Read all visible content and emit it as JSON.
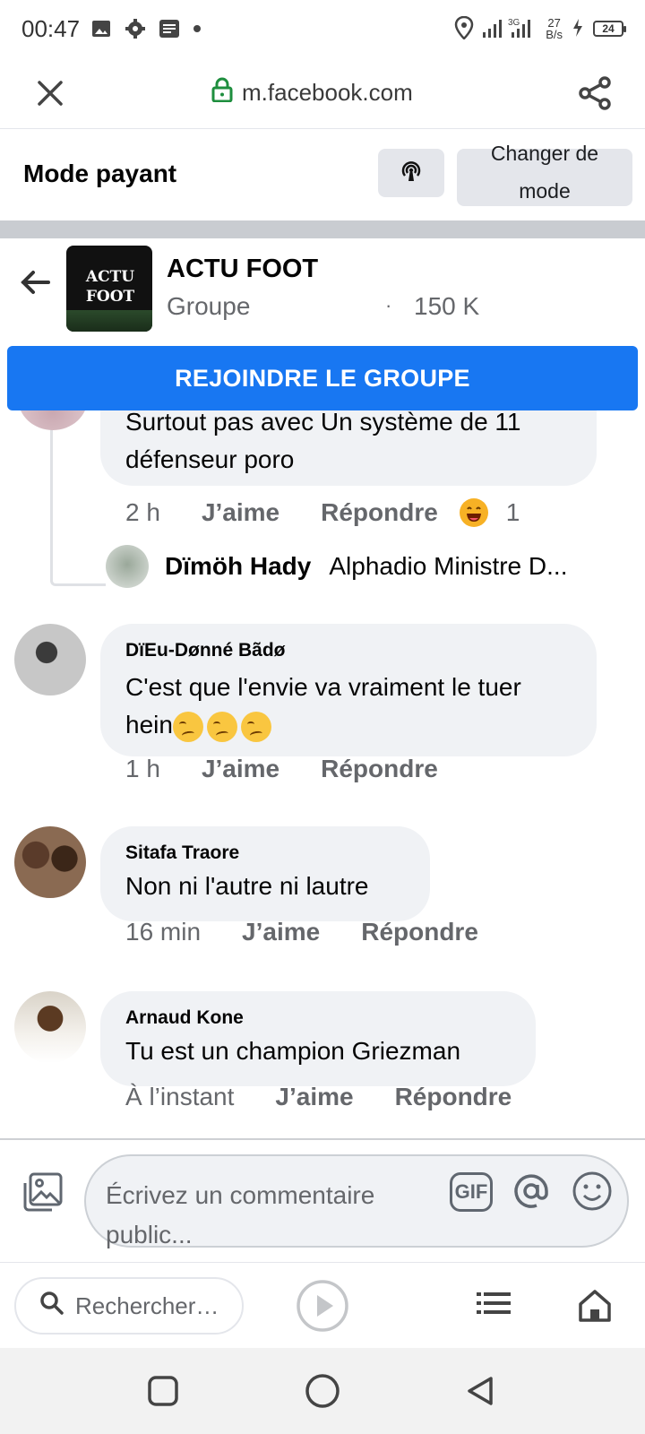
{
  "status_bar": {
    "time": "00:47",
    "network": "3G",
    "speed_value": "27",
    "speed_unit": "B/s",
    "battery": "24",
    "icons": [
      "image-icon",
      "settings-icon",
      "news-icon",
      "dot-icon",
      "location-icon",
      "signal-icon",
      "charging-icon"
    ]
  },
  "browser": {
    "url": "m.facebook.com",
    "close_icon": "close-icon",
    "share_icon": "share-icon"
  },
  "mode_bar": {
    "title": "Mode payant",
    "change_mode_label": "Changer de mode"
  },
  "group": {
    "logo_text": "ACTU FOOT",
    "name": "ACTU FOOT",
    "type": "Groupe",
    "separator": "·",
    "members": "150 K",
    "join_label": "REJOINDRE LE GROUPE"
  },
  "comments": {
    "first": {
      "text": "Surtout pas avec Un système de 11 défenseur poro",
      "time": "2 h",
      "like_label": "J’aime",
      "reply_label": "Répondre",
      "reaction_count": "1"
    },
    "reply_preview": {
      "author": "Dïmöh Hady",
      "text": "Alphadio Ministre D..."
    },
    "items": [
      {
        "author": "DïEu-Dønné Bãdø",
        "text": "C'est que l'envie va vraiment le tuer hein",
        "time": "1 h",
        "like_label": "J’aime",
        "reply_label": "Répondre"
      },
      {
        "author": "Sitafa Traore",
        "text": "Non ni l'autre ni lautre",
        "time": "16 min",
        "like_label": "J’aime",
        "reply_label": "Répondre"
      },
      {
        "author": "Arnaud Kone",
        "text": "Tu est un champion Griezman",
        "time": "À l’instant",
        "like_label": "J’aime",
        "reply_label": "Répondre"
      }
    ]
  },
  "composer": {
    "placeholder": "Écrivez un commentaire public...",
    "gif_label": "GIF"
  },
  "bottom_bar": {
    "search_placeholder": "Rechercher…"
  },
  "colors": {
    "brand_blue": "#1877f2",
    "bubble_bg": "#f0f2f5",
    "secondary_text": "#65676b"
  }
}
